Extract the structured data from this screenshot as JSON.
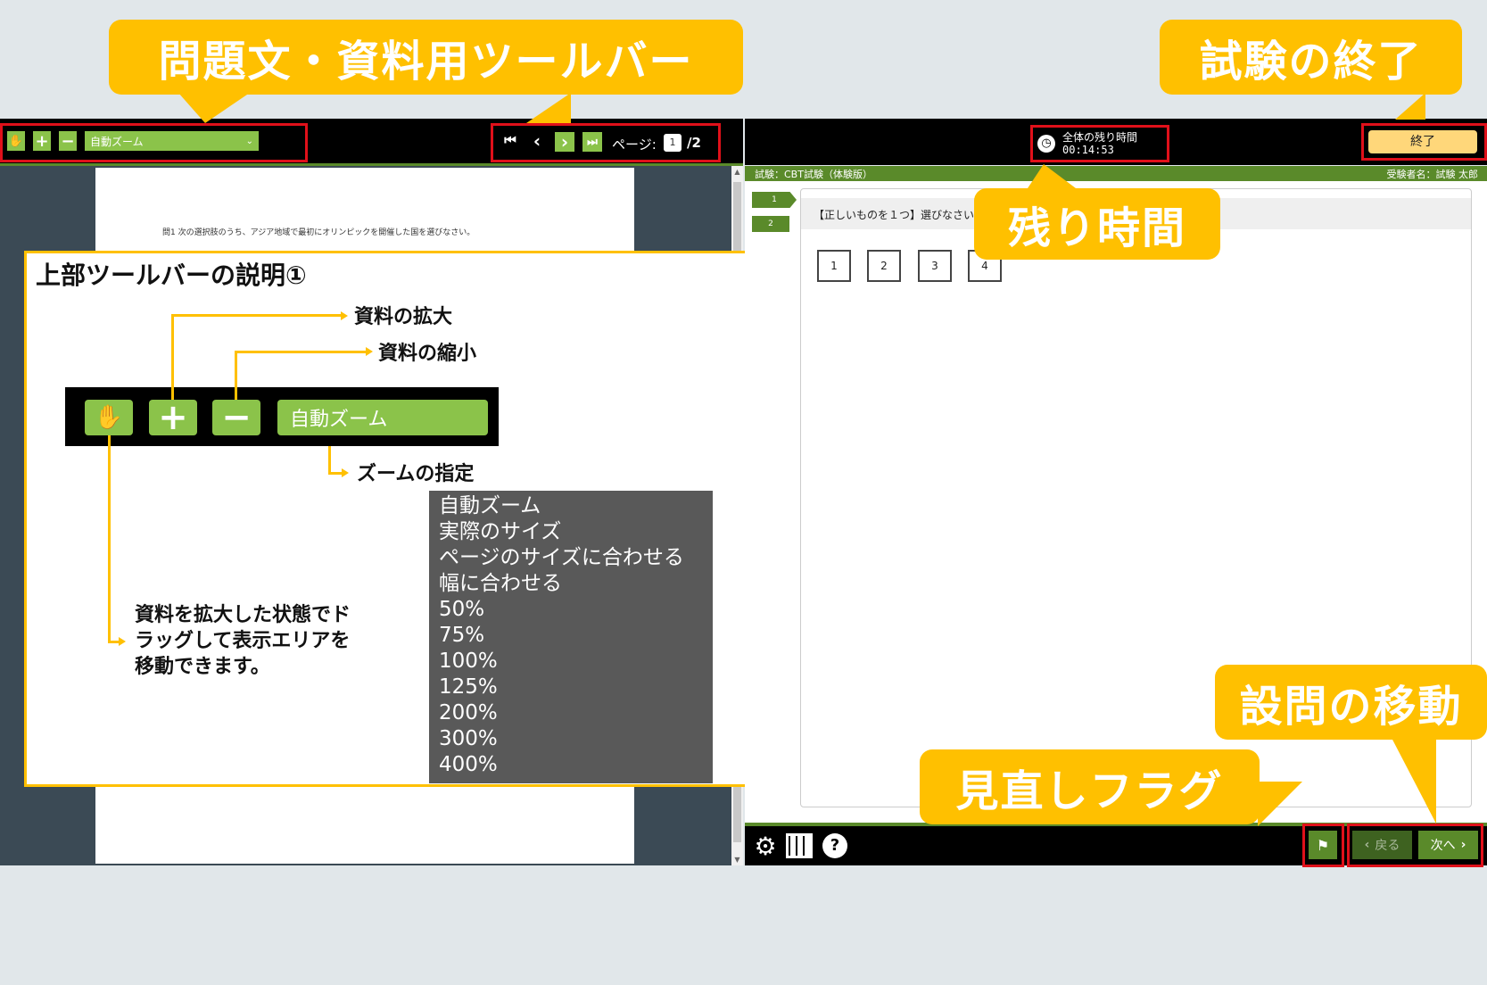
{
  "callouts": {
    "toolbar": "問題文・資料用ツールバー",
    "end_exam": "試験の終了",
    "remaining_time": "残り時間",
    "navigation": "設問の移動",
    "review_flag": "見直しフラグ"
  },
  "left_toolbar": {
    "zoom_select": "自動ズーム",
    "page_label": "ページ:",
    "page_current": "1",
    "page_total": "/2"
  },
  "document": {
    "question": "問1 次の選択肢のうち、アジア地域で最初にオリンピックを開催した国を選びなさい。"
  },
  "explanation": {
    "title": "上部ツールバーの説明①",
    "zoom_in": "資料の拡大",
    "zoom_out": "資料の縮小",
    "zoom_select_label": "ズームの指定",
    "zoom_select_value": "自動ズーム",
    "hand_desc": [
      "資料を拡大した状態でド",
      "ラッグして表示エリアを",
      "移動できます。"
    ],
    "zoom_options": [
      "自動ズーム",
      "実際のサイズ",
      "ページのサイズに合わせる",
      "幅に合わせる",
      "50%",
      "75%",
      "100%",
      "125%",
      "200%",
      "300%",
      "400%"
    ]
  },
  "right_header": {
    "timer_label": "全体の残り時間",
    "timer_value": "00:14:53",
    "end_button": "終了",
    "exam_name": "試験：CBT試験（体験版）",
    "candidate": "受験者名：試験 太郎"
  },
  "question_panel": {
    "tabs": [
      "1",
      "2"
    ],
    "instruction": "【正しいものを１つ】選びなさい",
    "choices": [
      "1",
      "2",
      "3",
      "4"
    ]
  },
  "bottom_bar": {
    "back_button": "戻る",
    "next_button": "次へ"
  },
  "colors": {
    "accent": "#ffc000",
    "green": "#8bc34a",
    "dark_green": "#5a8a2a",
    "highlight": "#e0101a"
  }
}
